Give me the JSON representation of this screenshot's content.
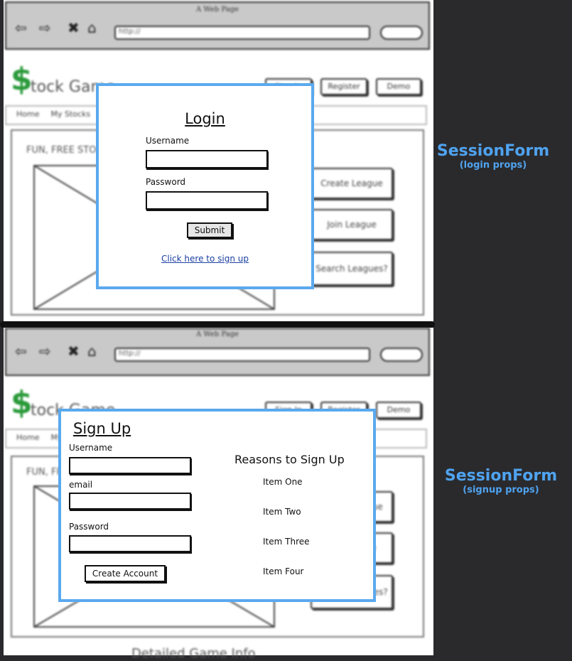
{
  "browser": {
    "window_title": "A Web Page",
    "url": "http://"
  },
  "site": {
    "logo_dollar": "$",
    "logo_text": "tock Game",
    "header_buttons": [
      "Sign In",
      "Register",
      "Demo"
    ],
    "nav": [
      "Home",
      "My Stocks"
    ],
    "tagline": "FUN, FREE STOCK GAME",
    "side_buttons": [
      "Create League",
      "Join League",
      "Search Leagues?"
    ],
    "footer_heading": "Detailed Game Info"
  },
  "login": {
    "title": "Login",
    "username_label": "Username",
    "password_label": "Password",
    "submit_label": "Submit",
    "signup_link": "Click here to sign up"
  },
  "signup": {
    "title": "Sign Up",
    "username_label": "Username",
    "email_label": "email",
    "password_label": "Password",
    "create_label": "Create Account",
    "reasons_title": "Reasons to Sign Up",
    "reasons": [
      "Item One",
      "Item Two",
      "Item Three",
      "Item Four"
    ]
  },
  "annotations": {
    "top_title": "SessionForm",
    "top_sub": "(login props)",
    "bottom_title": "SessionForm",
    "bottom_sub": "(signup props)"
  },
  "colors": {
    "modal_border": "#5aa9ee",
    "annotation_text": "#4fa3f0",
    "logo_green": "#2a9a3a"
  }
}
